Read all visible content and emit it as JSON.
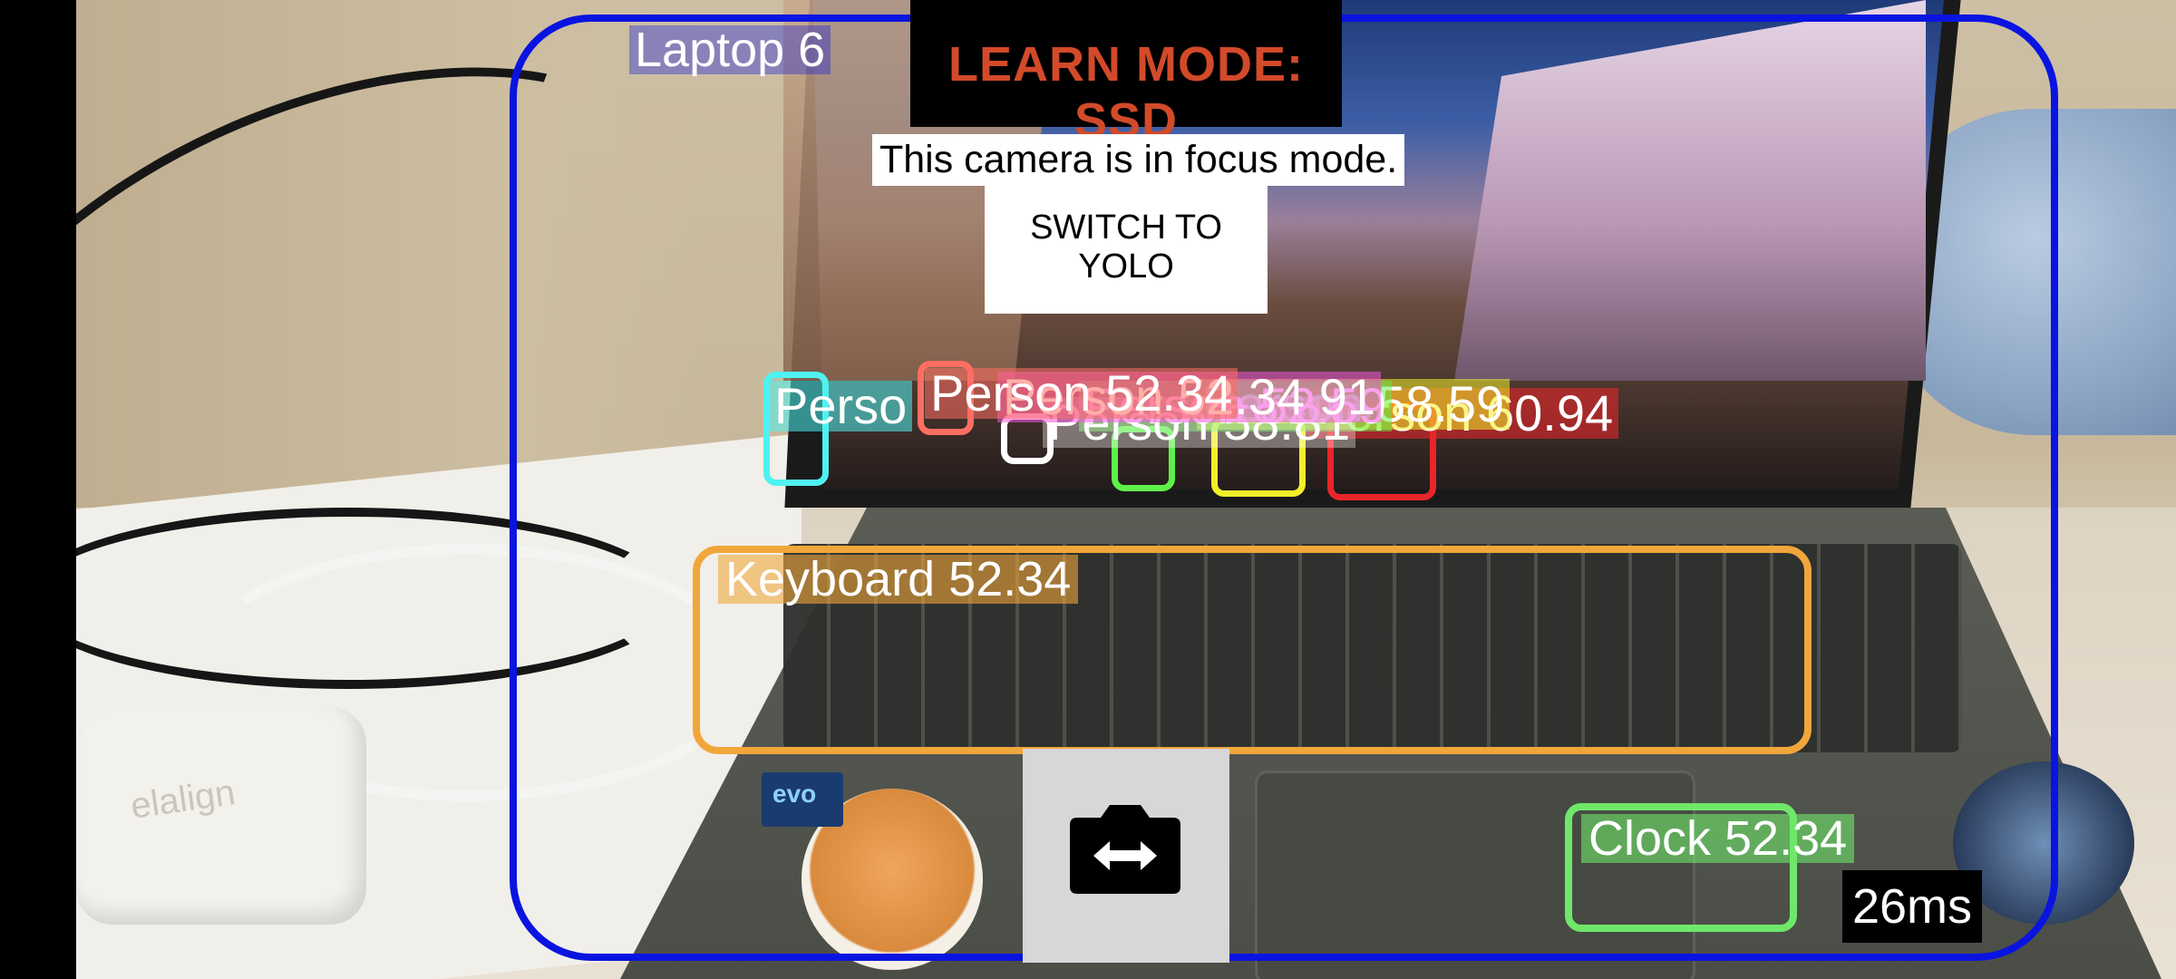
{
  "camera": {
    "mode_title": "LEARN  MODE: SSD",
    "focus_message": "This camera is in focus mode.",
    "switch_button_label": "SWITCH TO YOLO",
    "flip_camera_icon": "camera-switch-icon",
    "latency": "26ms"
  },
  "detections": {
    "laptop_label": "Laptop 6",
    "keyboard_label": "Keyboard 52.34",
    "clock_label": "Clock 52.34",
    "person_labels": {
      "cyan": "Perso",
      "salmon": "Person 52.34",
      "magenta": "Person 52.34 91",
      "white": "Person 58.81",
      "green": "Person 52.59",
      "yellow": "Person 58.59",
      "red": "Person 60.94"
    }
  },
  "colors": {
    "laptop_box": "#0a14e0",
    "keyboard_box": "#f0a63a",
    "clock_box": "#6fe86a",
    "mode_text": "#d24a2a",
    "person_cyan": "#4ff2f2",
    "person_salmon": "#ff6e62",
    "person_white": "#ffffff",
    "person_green": "#5ef04a",
    "person_yellow": "#f2ef2a",
    "person_red": "#e8262a"
  }
}
